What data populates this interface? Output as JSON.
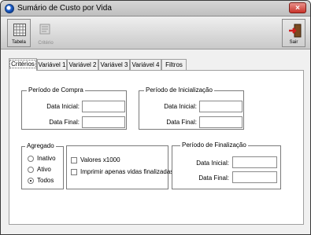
{
  "window": {
    "title": "Sumário de Custo por Vida",
    "close_glyph": "×"
  },
  "toolbar": {
    "tabelas_label": "Tabela",
    "criterio_label": "Critério",
    "sair_label": "Sair",
    "icons": [
      "grid-table-icon",
      "criteria-icon",
      "exit-door-icon"
    ]
  },
  "tabs": [
    {
      "label": "Critérios",
      "active": true
    },
    {
      "label": "Variável 1"
    },
    {
      "label": "Variável 2"
    },
    {
      "label": "Variável 3"
    },
    {
      "label": "Variável 4"
    },
    {
      "label": "Filtros"
    }
  ],
  "compra": {
    "title": "Período de Compra",
    "inicial_label": "Data Inicial:",
    "final_label": "Data Final:",
    "inicial_value": "",
    "final_value": ""
  },
  "inicializacao": {
    "title": "Período de Inicialização",
    "inicial_label": "Data Inicial:",
    "final_label": "Data Final:",
    "inicial_value": "",
    "final_value": ""
  },
  "agregado": {
    "title": "Agregado",
    "options": [
      "Inativo",
      "Ativo",
      "Todos"
    ],
    "selected": "Todos"
  },
  "opcoes": {
    "valores_label": "Valores x1000",
    "valores_checked": false,
    "imprimir_label": "Imprimir apenas vidas finalizadas",
    "imprimir_checked": false
  },
  "finalizacao": {
    "title": "Período de Finalização",
    "inicial_label": "Data Inicial:",
    "final_label": "Data Final:",
    "inicial_value": "",
    "final_value": ""
  },
  "colors": {
    "title_bar": "#c8c8c8",
    "close_button": "#c8332a",
    "panel_bg": "#ffffff",
    "window_bg": "#f0f0f0"
  }
}
